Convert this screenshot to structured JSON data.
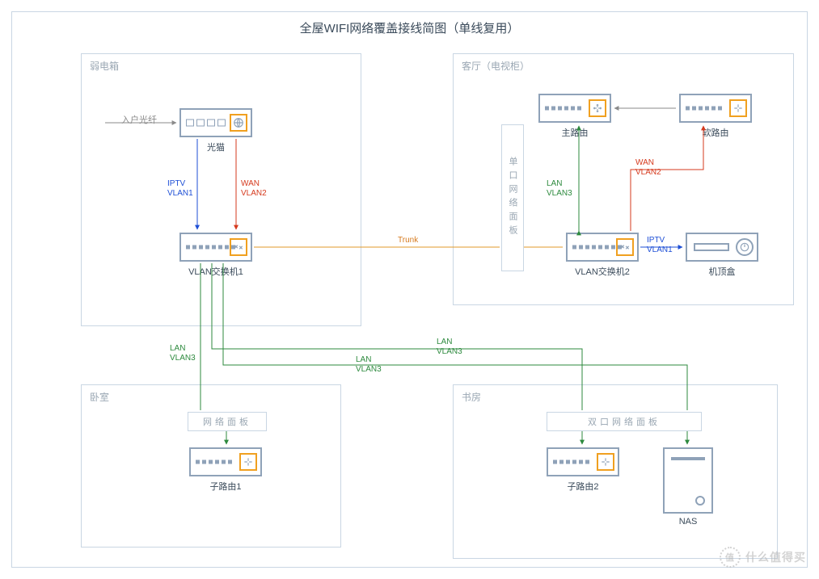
{
  "title": "全屋WIFI网络覆盖接线简图（单线复用）",
  "zones": {
    "weakbox": "弱电箱",
    "living": "客厅（电视柜）",
    "bedroom": "卧室",
    "study": "书房"
  },
  "devices": {
    "modem": "光猫",
    "vlan_sw1": "VLAN交换机1",
    "vlan_sw2": "VLAN交换机2",
    "main_rt": "主路由",
    "soft_rt": "软路由",
    "stb": "机顶盒",
    "sub_rt1": "子路由1",
    "sub_rt2": "子路由2",
    "nas": "NAS"
  },
  "faceplates": {
    "vertical": "单口网络面板",
    "bedroom": "网络面板",
    "study": "双口网络面板"
  },
  "labels": {
    "fiber": "入户光纤",
    "iptv_vlan1": "IPTV\nVLAN1",
    "wan_vlan2": "WAN\nVLAN2",
    "lan_vlan3": "LAN\nVLAN3",
    "trunk": "Trunk"
  },
  "watermark": {
    "badge": "值",
    "text": "什么值得买"
  },
  "chart_data": {
    "type": "network-diagram",
    "zones": [
      {
        "id": "weakbox",
        "label": "弱电箱"
      },
      {
        "id": "living",
        "label": "客厅（电视柜）"
      },
      {
        "id": "bedroom",
        "label": "卧室"
      },
      {
        "id": "study",
        "label": "书房"
      }
    ],
    "nodes": [
      {
        "id": "fiber_in",
        "label": "入户光纤",
        "zone": "weakbox",
        "type": "external"
      },
      {
        "id": "modem",
        "label": "光猫",
        "zone": "weakbox",
        "type": "modem"
      },
      {
        "id": "vlan_sw1",
        "label": "VLAN交换机1",
        "zone": "weakbox",
        "type": "switch"
      },
      {
        "id": "panel_single",
        "label": "单口网络面板",
        "zone": "living",
        "type": "faceplate"
      },
      {
        "id": "main_rt",
        "label": "主路由",
        "zone": "living",
        "type": "router"
      },
      {
        "id": "soft_rt",
        "label": "软路由",
        "zone": "living",
        "type": "router"
      },
      {
        "id": "vlan_sw2",
        "label": "VLAN交换机2",
        "zone": "living",
        "type": "switch"
      },
      {
        "id": "stb",
        "label": "机顶盒",
        "zone": "living",
        "type": "settop"
      },
      {
        "id": "panel_bed",
        "label": "网络面板",
        "zone": "bedroom",
        "type": "faceplate"
      },
      {
        "id": "sub_rt1",
        "label": "子路由1",
        "zone": "bedroom",
        "type": "router"
      },
      {
        "id": "panel_study",
        "label": "双口网络面板",
        "zone": "study",
        "type": "faceplate"
      },
      {
        "id": "sub_rt2",
        "label": "子路由2",
        "zone": "study",
        "type": "router"
      },
      {
        "id": "nas",
        "label": "NAS",
        "zone": "study",
        "type": "nas"
      }
    ],
    "edges": [
      {
        "from": "fiber_in",
        "to": "modem",
        "label": "入户光纤",
        "color": "gray"
      },
      {
        "from": "modem",
        "to": "vlan_sw1",
        "label": "IPTV VLAN1",
        "color": "blue"
      },
      {
        "from": "modem",
        "to": "vlan_sw1",
        "label": "WAN VLAN2",
        "color": "red"
      },
      {
        "from": "vlan_sw1",
        "to": "panel_single",
        "label": "Trunk",
        "color": "orange"
      },
      {
        "from": "panel_single",
        "to": "vlan_sw2",
        "label": "Trunk",
        "color": "orange"
      },
      {
        "from": "vlan_sw2",
        "to": "main_rt",
        "label": "LAN VLAN3",
        "color": "green"
      },
      {
        "from": "vlan_sw2",
        "to": "soft_rt",
        "label": "WAN VLAN2",
        "color": "red"
      },
      {
        "from": "soft_rt",
        "to": "main_rt",
        "label": "",
        "color": "gray"
      },
      {
        "from": "vlan_sw2",
        "to": "stb",
        "label": "IPTV VLAN1",
        "color": "blue"
      },
      {
        "from": "vlan_sw1",
        "to": "panel_bed",
        "label": "LAN VLAN3",
        "color": "green"
      },
      {
        "from": "panel_bed",
        "to": "sub_rt1",
        "label": "",
        "color": "green"
      },
      {
        "from": "vlan_sw1",
        "to": "panel_study",
        "label": "LAN VLAN3",
        "color": "green"
      },
      {
        "from": "vlan_sw1",
        "to": "panel_study",
        "label": "LAN VLAN3",
        "color": "green"
      },
      {
        "from": "panel_study",
        "to": "sub_rt2",
        "label": "",
        "color": "green"
      },
      {
        "from": "panel_study",
        "to": "nas",
        "label": "",
        "color": "green"
      }
    ]
  }
}
